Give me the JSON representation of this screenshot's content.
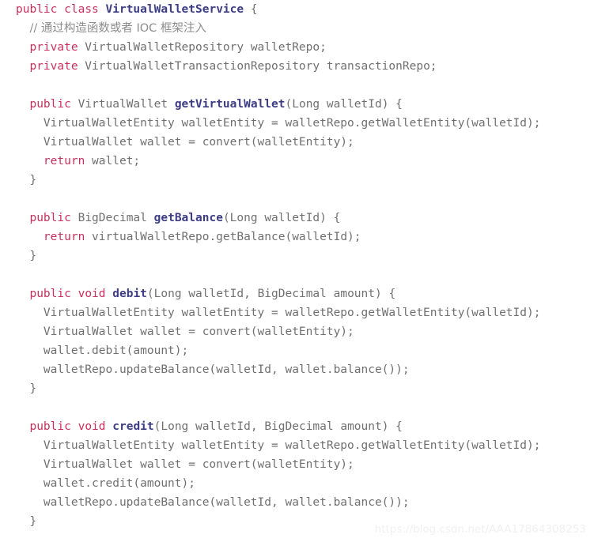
{
  "editor": {
    "language": "java",
    "background_color": "#ffffff",
    "colors": {
      "keyword": "#c8305e",
      "declaration_name": "#3d3d85",
      "comment": "#8c8c8c",
      "plain": "#707070",
      "watermark": "#f0f0f0"
    }
  },
  "watermark": {
    "text": "https://blog.csdn.net/AAA17864308253"
  },
  "code": {
    "lines": [
      {
        "index": 1,
        "text": "public class VirtualWalletService {",
        "tokens": [
          {
            "t": "public",
            "k": "kw"
          },
          {
            "t": " ",
            "k": "plain"
          },
          {
            "t": "class",
            "k": "kw"
          },
          {
            "t": " ",
            "k": "plain"
          },
          {
            "t": "VirtualWalletService",
            "k": "decl"
          },
          {
            "t": " {",
            "k": "plain"
          }
        ]
      },
      {
        "index": 2,
        "text": "  // 通过构造函数或者 IOC 框架注入",
        "tokens": [
          {
            "t": "  ",
            "k": "plain"
          },
          {
            "t": "// 通过构造函数或者 IOC 框架注入",
            "k": "cmt"
          }
        ]
      },
      {
        "index": 3,
        "text": "  private VirtualWalletRepository walletRepo;",
        "tokens": [
          {
            "t": "  ",
            "k": "plain"
          },
          {
            "t": "private",
            "k": "kw"
          },
          {
            "t": " VirtualWalletRepository walletRepo;",
            "k": "plain"
          }
        ]
      },
      {
        "index": 4,
        "text": "  private VirtualWalletTransactionRepository transactionRepo;",
        "tokens": [
          {
            "t": "  ",
            "k": "plain"
          },
          {
            "t": "private",
            "k": "kw"
          },
          {
            "t": " VirtualWalletTransactionRepository transactionRepo;",
            "k": "plain"
          }
        ]
      },
      {
        "index": 5,
        "text": "",
        "tokens": []
      },
      {
        "index": 6,
        "text": "  public VirtualWallet getVirtualWallet(Long walletId) {",
        "tokens": [
          {
            "t": "  ",
            "k": "plain"
          },
          {
            "t": "public",
            "k": "kw"
          },
          {
            "t": " VirtualWallet ",
            "k": "plain"
          },
          {
            "t": "getVirtualWallet",
            "k": "decl"
          },
          {
            "t": "(Long walletId) {",
            "k": "plain"
          }
        ]
      },
      {
        "index": 7,
        "text": "    VirtualWalletEntity walletEntity = walletRepo.getWalletEntity(walletId);",
        "tokens": [
          {
            "t": "    VirtualWalletEntity walletEntity = walletRepo.getWalletEntity(walletId);",
            "k": "plain"
          }
        ]
      },
      {
        "index": 8,
        "text": "    VirtualWallet wallet = convert(walletEntity);",
        "tokens": [
          {
            "t": "    VirtualWallet wallet = convert(walletEntity);",
            "k": "plain"
          }
        ]
      },
      {
        "index": 9,
        "text": "    return wallet;",
        "tokens": [
          {
            "t": "    ",
            "k": "plain"
          },
          {
            "t": "return",
            "k": "kw"
          },
          {
            "t": " wallet;",
            "k": "plain"
          }
        ]
      },
      {
        "index": 10,
        "text": "  }",
        "tokens": [
          {
            "t": "  }",
            "k": "plain"
          }
        ]
      },
      {
        "index": 11,
        "text": "",
        "tokens": []
      },
      {
        "index": 12,
        "text": "  public BigDecimal getBalance(Long walletId) {",
        "tokens": [
          {
            "t": "  ",
            "k": "plain"
          },
          {
            "t": "public",
            "k": "kw"
          },
          {
            "t": " BigDecimal ",
            "k": "plain"
          },
          {
            "t": "getBalance",
            "k": "decl"
          },
          {
            "t": "(Long walletId) {",
            "k": "plain"
          }
        ]
      },
      {
        "index": 13,
        "text": "    return virtualWalletRepo.getBalance(walletId);",
        "tokens": [
          {
            "t": "    ",
            "k": "plain"
          },
          {
            "t": "return",
            "k": "kw"
          },
          {
            "t": " virtualWalletRepo.getBalance(walletId);",
            "k": "plain"
          }
        ]
      },
      {
        "index": 14,
        "text": "  }",
        "tokens": [
          {
            "t": "  }",
            "k": "plain"
          }
        ]
      },
      {
        "index": 15,
        "text": "",
        "tokens": []
      },
      {
        "index": 16,
        "text": "  public void debit(Long walletId, BigDecimal amount) {",
        "tokens": [
          {
            "t": "  ",
            "k": "plain"
          },
          {
            "t": "public",
            "k": "kw"
          },
          {
            "t": " ",
            "k": "plain"
          },
          {
            "t": "void",
            "k": "kw"
          },
          {
            "t": " ",
            "k": "plain"
          },
          {
            "t": "debit",
            "k": "decl"
          },
          {
            "t": "(Long walletId, BigDecimal amount) {",
            "k": "plain"
          }
        ]
      },
      {
        "index": 17,
        "text": "    VirtualWalletEntity walletEntity = walletRepo.getWalletEntity(walletId);",
        "tokens": [
          {
            "t": "    VirtualWalletEntity walletEntity = walletRepo.getWalletEntity(walletId);",
            "k": "plain"
          }
        ]
      },
      {
        "index": 18,
        "text": "    VirtualWallet wallet = convert(walletEntity);",
        "tokens": [
          {
            "t": "    VirtualWallet wallet = convert(walletEntity);",
            "k": "plain"
          }
        ]
      },
      {
        "index": 19,
        "text": "    wallet.debit(amount);",
        "tokens": [
          {
            "t": "    wallet.debit(amount);",
            "k": "plain"
          }
        ]
      },
      {
        "index": 20,
        "text": "    walletRepo.updateBalance(walletId, wallet.balance());",
        "tokens": [
          {
            "t": "    walletRepo.updateBalance(walletId, wallet.balance());",
            "k": "plain"
          }
        ]
      },
      {
        "index": 21,
        "text": "  }",
        "tokens": [
          {
            "t": "  }",
            "k": "plain"
          }
        ]
      },
      {
        "index": 22,
        "text": "",
        "tokens": []
      },
      {
        "index": 23,
        "text": "  public void credit(Long walletId, BigDecimal amount) {",
        "tokens": [
          {
            "t": "  ",
            "k": "plain"
          },
          {
            "t": "public",
            "k": "kw"
          },
          {
            "t": " ",
            "k": "plain"
          },
          {
            "t": "void",
            "k": "kw"
          },
          {
            "t": " ",
            "k": "plain"
          },
          {
            "t": "credit",
            "k": "decl"
          },
          {
            "t": "(Long walletId, BigDecimal amount) {",
            "k": "plain"
          }
        ]
      },
      {
        "index": 24,
        "text": "    VirtualWalletEntity walletEntity = walletRepo.getWalletEntity(walletId);",
        "tokens": [
          {
            "t": "    VirtualWalletEntity walletEntity = walletRepo.getWalletEntity(walletId);",
            "k": "plain"
          }
        ]
      },
      {
        "index": 25,
        "text": "    VirtualWallet wallet = convert(walletEntity);",
        "tokens": [
          {
            "t": "    VirtualWallet wallet = convert(walletEntity);",
            "k": "plain"
          }
        ]
      },
      {
        "index": 26,
        "text": "    wallet.credit(amount);",
        "tokens": [
          {
            "t": "    wallet.credit(amount);",
            "k": "plain"
          }
        ]
      },
      {
        "index": 27,
        "text": "    walletRepo.updateBalance(walletId, wallet.balance());",
        "tokens": [
          {
            "t": "    walletRepo.updateBalance(walletId, wallet.balance());",
            "k": "plain"
          }
        ]
      },
      {
        "index": 28,
        "text": "  }",
        "tokens": [
          {
            "t": "  }",
            "k": "plain"
          }
        ]
      }
    ]
  }
}
